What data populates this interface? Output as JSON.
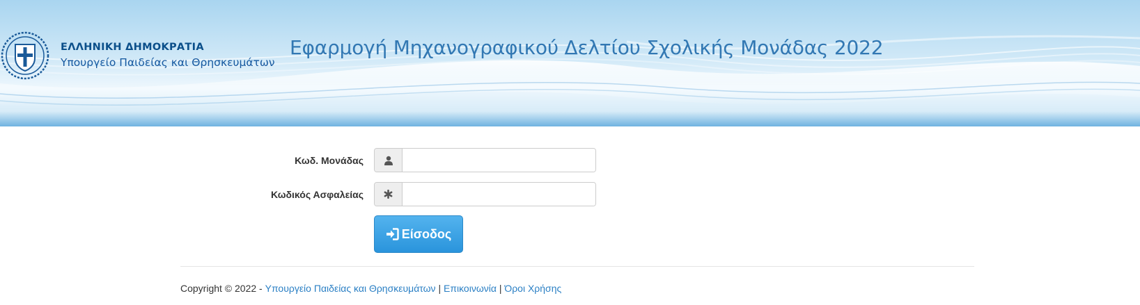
{
  "header": {
    "gov_title": "ΕΛΛΗΝΙΚΗ ΔΗΜΟΚΡΑΤΙΑ",
    "ministry": "Υπουργείο Παιδείας και Θρησκευμάτων",
    "app_title": "Εφαρμογή Μηχανογραφικού Δελτίου Σχολικής Μονάδας 2022"
  },
  "form": {
    "unit_code_label": "Κωδ. Μονάδας",
    "unit_code_value": "",
    "unit_code_icon": "user-icon",
    "password_label": "Κωδικός Ασφαλείας",
    "password_value": "",
    "password_icon": "asterisk-icon",
    "login_label": "Είσοδος",
    "login_icon": "log-in-icon"
  },
  "footer": {
    "copyright": "Copyright © 2022 - ",
    "ministry_link": "Υπουργείο Παιδείας και Θρησκευμάτων",
    "separator": " | ",
    "contact_link": "Επικοινωνία",
    "terms_link": "Όροι Χρήσης"
  },
  "colors": {
    "accent": "#2a94dc",
    "link": "#2a7fc4",
    "title": "#3278b3",
    "gov_text": "#0b4f8a"
  }
}
